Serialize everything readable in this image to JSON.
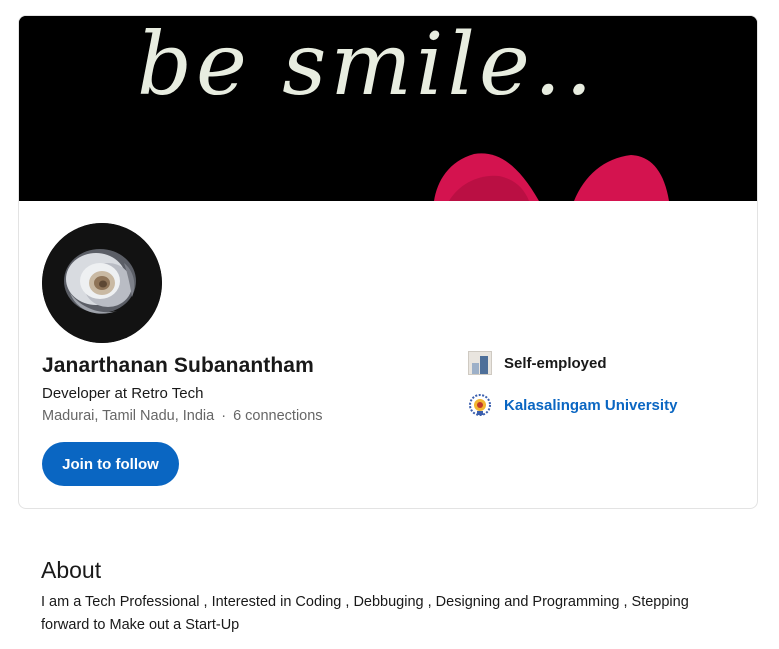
{
  "profile": {
    "banner_text": "be smile..",
    "name": "Janarthanan Subanantham",
    "headline": "Developer at Retro Tech",
    "location": "Madurai, Tamil Nadu, India",
    "separator": "·",
    "connections": "6 connections",
    "follow_label": "Join to follow",
    "avatar_icon": "rose-photo",
    "accent_color": "#0a66c2"
  },
  "orgs": [
    {
      "label": "Self-employed",
      "icon": "company-logo-icon"
    },
    {
      "label": "Kalasalingam University",
      "icon": "university-logo-icon"
    }
  ],
  "about": {
    "title": "About",
    "text": "I am a Tech Professional , Interested in Coding , Debbuging , Designing and Programming , Stepping forward to Make out a Start-Up"
  }
}
